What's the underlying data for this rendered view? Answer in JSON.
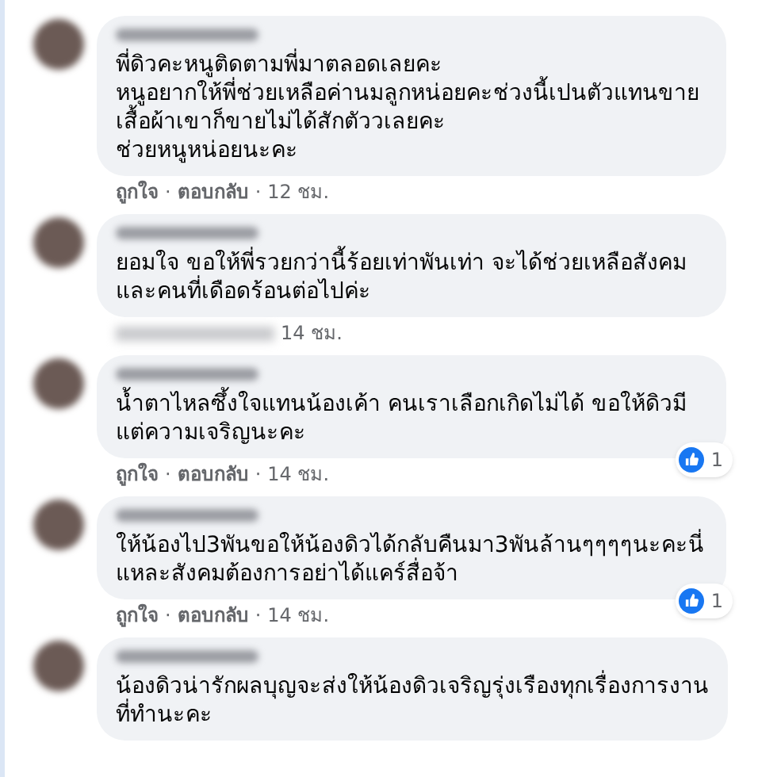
{
  "comments": [
    {
      "lines": [
        "พี่ดิวคะหนูติดตามพี่มาตลอดเลยคะ",
        "หนูอยากให้พี่ช่วยเหลือค่านมลูกหน่อยคะช่วงนี้เปนตัวแทนขาย",
        "เสื้อผ้าเขาก็ขายไม่ได้สักตัววเลยคะ",
        "ช่วยหนูหน่อยนะคะ"
      ],
      "footer": [
        {
          "kind": "link",
          "text": "ถูกใจ"
        },
        {
          "kind": "sep",
          "text": "·"
        },
        {
          "kind": "link",
          "text": "ตอบกลับ"
        },
        {
          "kind": "sep",
          "text": "·"
        },
        {
          "kind": "time",
          "text": "12 ชม."
        }
      ]
    },
    {
      "lines": [
        "ยอมใจ ขอให้พี่รวยกว่านี้ร้อยเท่าพันเท่า จะได้ช่วยเหลือสังคม",
        "และคนที่เดือดร้อนต่อไปค่ะ"
      ],
      "footer": [
        {
          "kind": "blur"
        },
        {
          "kind": "time",
          "text": "14 ชม."
        }
      ]
    },
    {
      "lines": [
        "น้ำตาไหลซึ้งใจแทนน้องเค้า คนเราเลือกเกิดไม่ได้ ขอให้ดิวมี",
        "แต่ความเจริญนะคะ"
      ],
      "footer": [
        {
          "kind": "link",
          "text": "ถูกใจ"
        },
        {
          "kind": "sep",
          "text": "·"
        },
        {
          "kind": "link",
          "text": "ตอบกลับ"
        },
        {
          "kind": "sep",
          "text": "·"
        },
        {
          "kind": "time",
          "text": "14 ชม."
        }
      ],
      "reactions": "1"
    },
    {
      "lines": [
        "ให้น้องไป3พันขอให้น้องดิวได้กลับคืนมา3พันล้านๆๆๆๆนะคะนี่",
        "แหละสังคมต้องการอย่าได้แคร์สื่อจ้า"
      ],
      "footer": [
        {
          "kind": "link",
          "text": "ถูกใจ"
        },
        {
          "kind": "sep",
          "text": "·"
        },
        {
          "kind": "link",
          "text": "ตอบกลับ"
        },
        {
          "kind": "sep",
          "text": "·"
        },
        {
          "kind": "time",
          "text": "14 ชม."
        }
      ],
      "reactions": "1"
    },
    {
      "lines": [
        "น้องดิวน่ารักผลบุญจะส่งให้น้องดิวเจริญรุ่งเรืองทุกเรื่องการงาน",
        "ที่ทำนะคะ"
      ]
    }
  ]
}
